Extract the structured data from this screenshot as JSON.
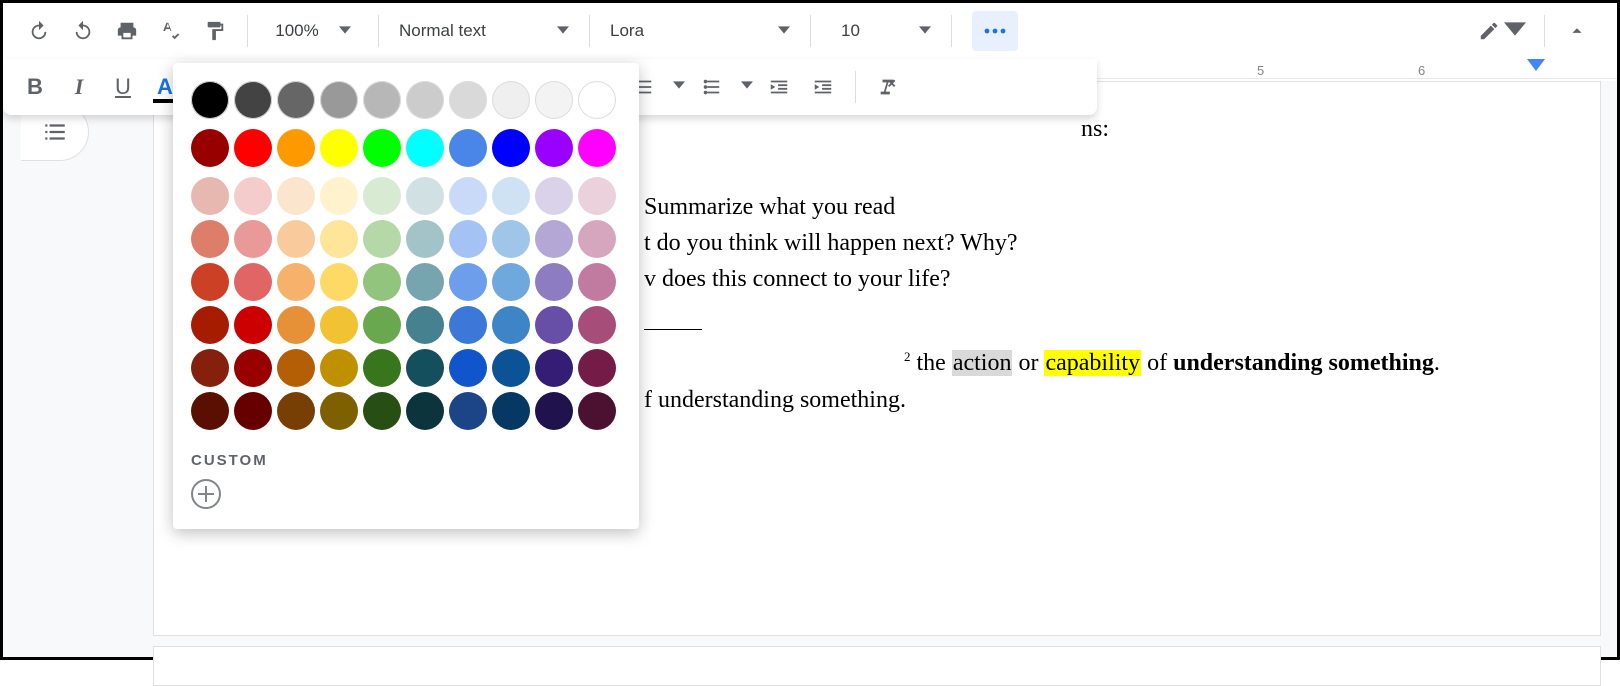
{
  "toolbar": {
    "zoom": "100%",
    "style": "Normal text",
    "font": "Lora",
    "size": "10"
  },
  "ruler": {
    "n5": "5",
    "n6": "6"
  },
  "doc": {
    "frag_ns": "ns:",
    "line1": "Summarize what you read",
    "line2": "t do you think will happen next? Why?",
    "line3_a": "v does this connect to your life?",
    "foot2": "2",
    "seg_the": " the ",
    "seg_action": "action",
    "seg_or": " or ",
    "seg_capability": "capability",
    "seg_of": " of ",
    "seg_bold": "understanding something",
    "seg_period": ".",
    "line_under": "f understanding something."
  },
  "colorpicker": {
    "custom_label": "CUSTOM",
    "grays": [
      "#000000",
      "#434343",
      "#666666",
      "#999999",
      "#b7b7b7",
      "#cccccc",
      "#d9d9d9",
      "#efefef",
      "#f3f3f3",
      "#ffffff"
    ],
    "brights": [
      "#980000",
      "#ff0000",
      "#ff9900",
      "#ffff00",
      "#00ff00",
      "#00ffff",
      "#4a86e8",
      "#0000ff",
      "#9900ff",
      "#ff00ff"
    ],
    "tints": [
      [
        "#e6b8af",
        "#f4cccc",
        "#fce5cd",
        "#fff2cc",
        "#d9ead3",
        "#d0e0e3",
        "#c9daf8",
        "#cfe2f3",
        "#d9d2e9",
        "#ead1dc"
      ],
      [
        "#dd7e6b",
        "#ea9999",
        "#f9cb9c",
        "#ffe599",
        "#b6d7a8",
        "#a2c4c9",
        "#a4c2f4",
        "#9fc5e8",
        "#b4a7d6",
        "#d5a6bd"
      ],
      [
        "#cc4125",
        "#e06666",
        "#f6b26b",
        "#ffd966",
        "#93c47d",
        "#76a5af",
        "#6d9eeb",
        "#6fa8dc",
        "#8e7cc3",
        "#c27ba0"
      ],
      [
        "#a61c00",
        "#cc0000",
        "#e69138",
        "#f1c232",
        "#6aa84f",
        "#45818e",
        "#3c78d8",
        "#3d85c6",
        "#674ea7",
        "#a64d79"
      ],
      [
        "#85200c",
        "#990000",
        "#b45f06",
        "#bf9000",
        "#38761d",
        "#134f5c",
        "#1155cc",
        "#0b5394",
        "#351c75",
        "#741b47"
      ],
      [
        "#5b0f00",
        "#660000",
        "#783f04",
        "#7f6000",
        "#274e13",
        "#0c343d",
        "#1c4587",
        "#073763",
        "#20124d",
        "#4c1130"
      ]
    ]
  }
}
